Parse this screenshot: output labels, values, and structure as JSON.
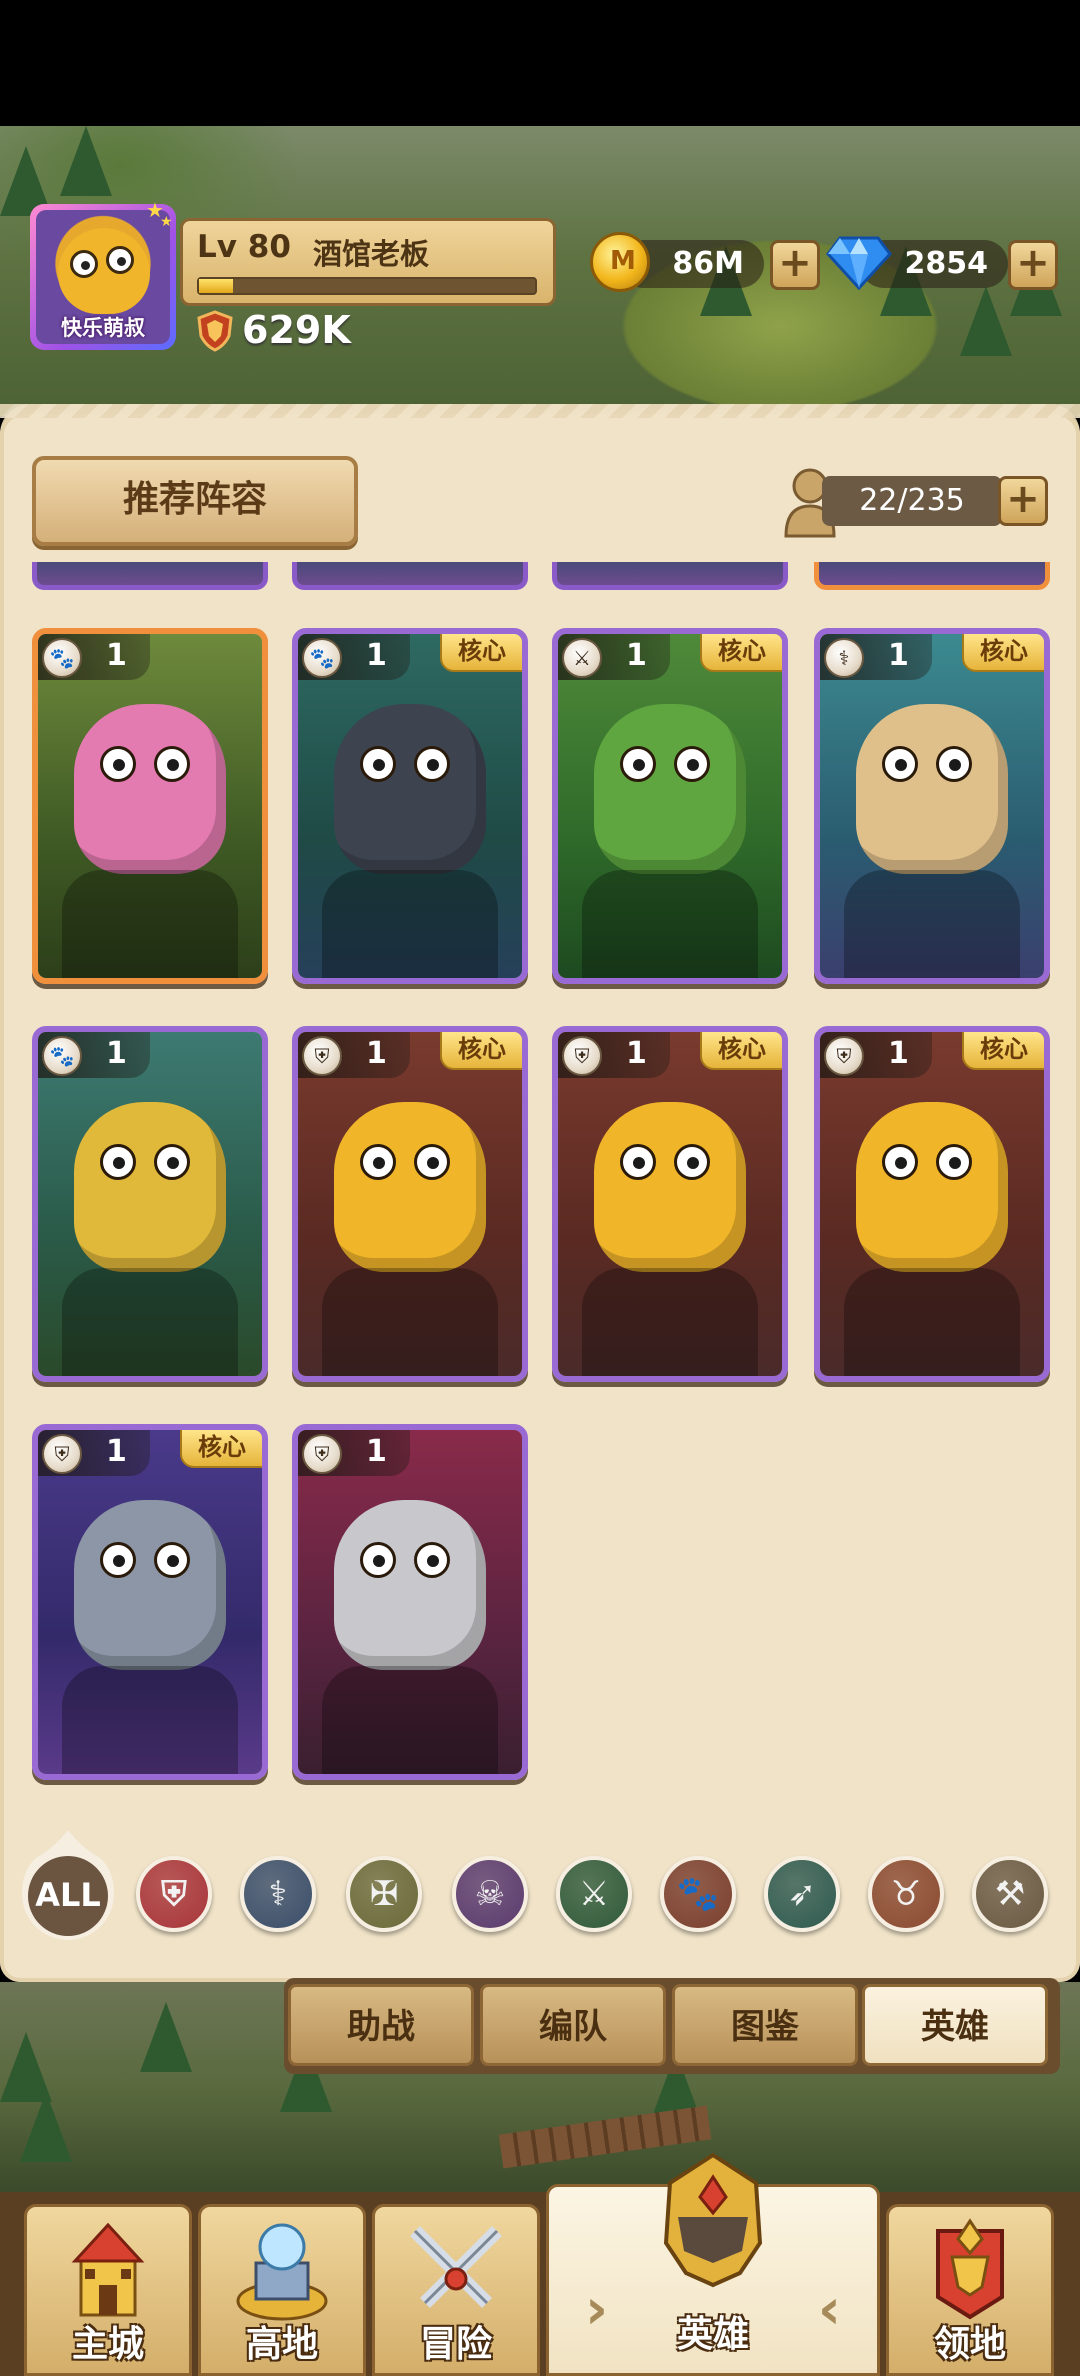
{
  "player": {
    "avatar_name": "快乐萌叔",
    "level": "Lv 80",
    "title": "酒馆老板",
    "xp_fraction": 0.1,
    "power": "629K"
  },
  "resources": {
    "gold": "86M",
    "gems": "2854"
  },
  "panel": {
    "recommend_label": "推荐阵容",
    "capacity": "22/235",
    "core_label": "核心"
  },
  "heroes": [
    {
      "name": "hero-elf-druid",
      "class_icon": "paw-icon",
      "level": "1",
      "core": false,
      "rarity": "orange"
    },
    {
      "name": "hero-dark-dragon",
      "class_icon": "paw-icon",
      "level": "1",
      "core": true,
      "rarity": "purple"
    },
    {
      "name": "hero-goblin-archer",
      "class_icon": "crossed-swords-icon",
      "level": "1",
      "core": true,
      "rarity": "purple"
    },
    {
      "name": "hero-blonde-elf",
      "class_icon": "staff-icon",
      "level": "1",
      "core": true,
      "rarity": "purple"
    },
    {
      "name": "hero-shaman",
      "class_icon": "paw-icon",
      "level": "1",
      "core": false,
      "rarity": "purple"
    },
    {
      "name": "hero-yellow-blob-1",
      "class_icon": "shield-icon",
      "level": "1",
      "core": true,
      "rarity": "purple"
    },
    {
      "name": "hero-yellow-blob-2",
      "class_icon": "shield-icon",
      "level": "1",
      "core": true,
      "rarity": "purple"
    },
    {
      "name": "hero-yellow-blob-3",
      "class_icon": "shield-icon",
      "level": "1",
      "core": true,
      "rarity": "purple"
    },
    {
      "name": "hero-death-knight",
      "class_icon": "shield-icon",
      "level": "1",
      "core": true,
      "rarity": "purple"
    },
    {
      "name": "hero-old-warrior",
      "class_icon": "shield-icon",
      "level": "1",
      "core": false,
      "rarity": "purple"
    }
  ],
  "filters": [
    {
      "name": "filter-all",
      "label": "ALL"
    },
    {
      "name": "filter-shield",
      "icon": "shield-icon"
    },
    {
      "name": "filter-staff",
      "icon": "staff-icon"
    },
    {
      "name": "filter-holy",
      "icon": "holy-icon"
    },
    {
      "name": "filter-skull",
      "icon": "skull-icon"
    },
    {
      "name": "filter-swords",
      "icon": "crossed-swords-icon"
    },
    {
      "name": "filter-paw",
      "icon": "paw-icon"
    },
    {
      "name": "filter-bow",
      "icon": "bow-icon"
    },
    {
      "name": "filter-horn",
      "icon": "horned-helmet-icon"
    },
    {
      "name": "filter-hammer",
      "icon": "hammer-icon"
    }
  ],
  "subtabs": [
    "助战",
    "编队",
    "图鉴",
    "英雄"
  ],
  "nav": [
    "主城",
    "高地",
    "冒险",
    "英雄",
    "领地"
  ],
  "colors": {
    "parchment": "#f0e3c8",
    "purple_border": "#9a6ad4",
    "orange_border": "#f08f3c",
    "core_gold": "#e6b43a"
  }
}
